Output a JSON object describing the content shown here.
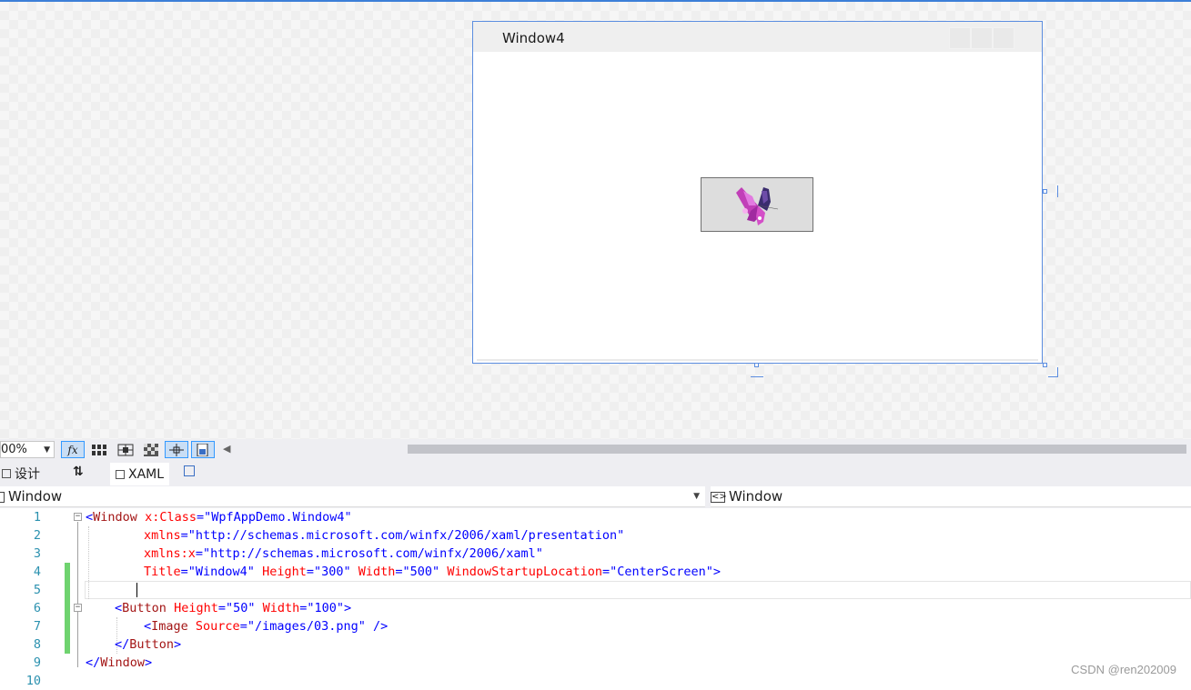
{
  "designer": {
    "window_title": "Window4"
  },
  "toolbar": {
    "zoom": "00%",
    "fx_label": "fx"
  },
  "tabs": {
    "design": "设计",
    "swap": "⇅",
    "xaml": "XAML"
  },
  "selectors": {
    "left": "Window",
    "right": "Window"
  },
  "editor": {
    "line_numbers": [
      "1",
      "2",
      "3",
      "4",
      "5",
      "6",
      "7",
      "8",
      "9",
      "10"
    ]
  },
  "colors": {
    "selection": "#5b8de0",
    "change_bar": "#6fd36f",
    "line_number": "#2b91af"
  },
  "watermark": "CSDN @ren202009"
}
